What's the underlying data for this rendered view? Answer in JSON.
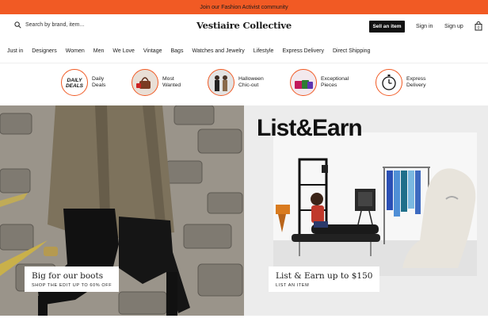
{
  "promo": {
    "text": "Join our Fashion Activist community"
  },
  "header": {
    "search_placeholder": "Search by brand, item...",
    "logo": "Vestiaire Collective",
    "sell_label": "Sell an item",
    "signin_label": "Sign in",
    "signup_label": "Sign up"
  },
  "nav": [
    "Just in",
    "Designers",
    "Women",
    "Men",
    "We Love",
    "Vintage",
    "Bags",
    "Watches and Jewelry",
    "Lifestyle",
    "Express Delivery",
    "Direct Shipping"
  ],
  "quick_links": [
    {
      "label1": "Daily",
      "label2": "Deals",
      "badge1": "DAILY",
      "badge2": "DEALS"
    },
    {
      "label1": "Most",
      "label2": "Wanted"
    },
    {
      "label1": "Halloween",
      "label2": "Chic-out"
    },
    {
      "label1": "Exceptional",
      "label2": "Pieces"
    },
    {
      "label1": "Express",
      "label2": "Delivery"
    }
  ],
  "hero_left": {
    "title": "Big for our boots",
    "subtitle": "SHOP THE EDIT UP TO 60% OFF"
  },
  "hero_right": {
    "headline": "List&Earn",
    "title": "List & Earn up to $150",
    "subtitle": "LIST AN ITEM"
  },
  "colors": {
    "accent": "#f15a24",
    "dark": "#111111"
  }
}
